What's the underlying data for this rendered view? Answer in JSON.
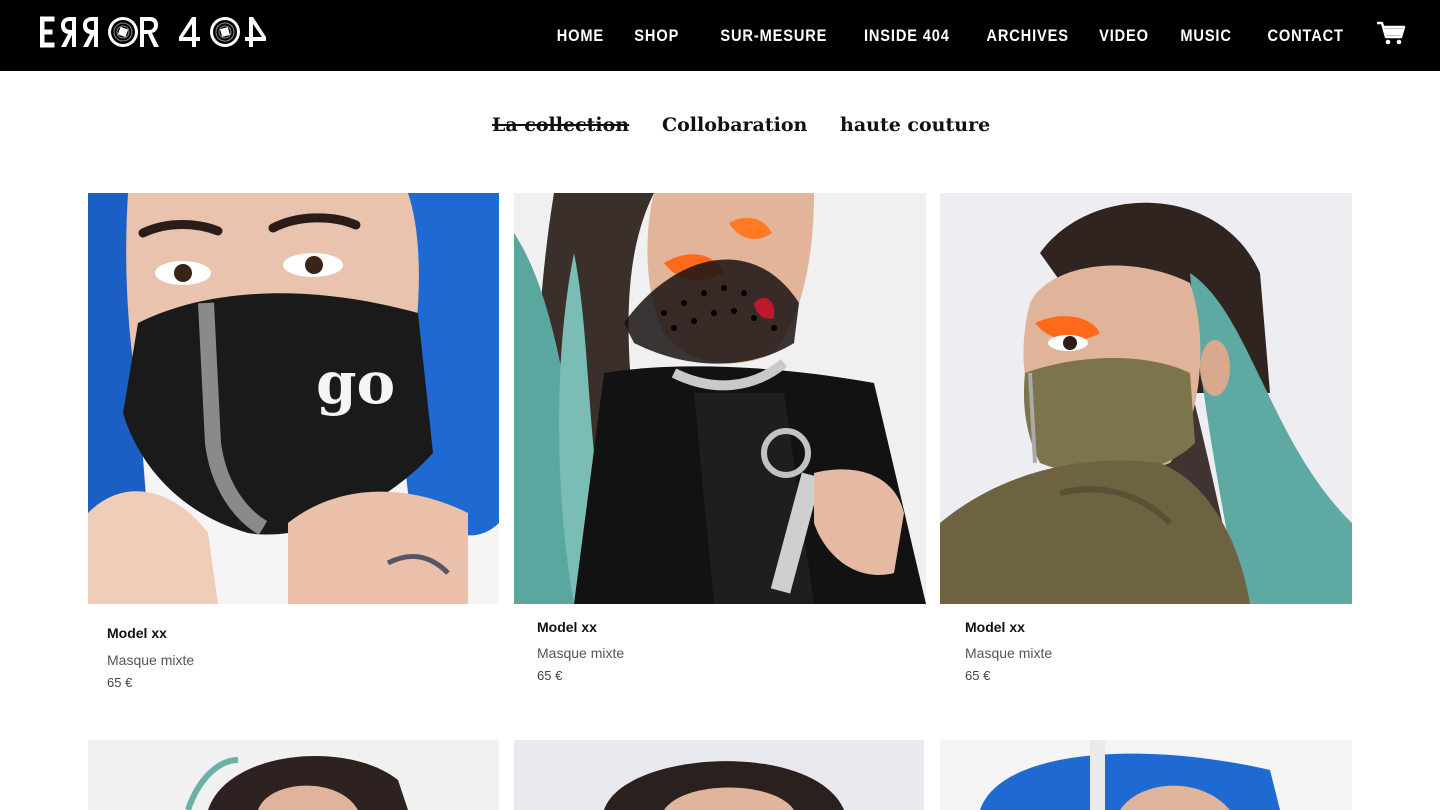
{
  "brand": {
    "logo_text": "ERROR 404",
    "logo_icon": "vinyl-disc-logo"
  },
  "nav": {
    "items": [
      "HOME",
      "SHOP",
      "SUR-MESURE",
      "INSIDE 404",
      "ARCHIVES",
      "VIDEO",
      "MUSIC",
      "CONTACT"
    ],
    "cart_icon": "cart-icon"
  },
  "subnav": {
    "items": [
      "La collection",
      "Collobaration",
      "haute couture"
    ],
    "active": "La collection"
  },
  "products": [
    {
      "name": "Model xx",
      "description": "Masque mixte",
      "price": "65 €",
      "mask_color": "#1a1a1a",
      "hair_color": "#1f6bd6",
      "bg": "#f3f3f3"
    },
    {
      "name": "Model xx",
      "description": "Masque mixte",
      "price": "65 €",
      "mask_color": "#2b2020",
      "hair_color": "#4d9b97",
      "bg": "#efefef"
    },
    {
      "name": "Model xx",
      "description": "Masque mixte",
      "price": "65 €",
      "mask_color": "#7b7348",
      "hair_color": "#3a2a24",
      "bg": "#ececf1"
    }
  ],
  "colors": {
    "header_bg": "#000000",
    "accent_orange": "#ff6a1a"
  }
}
